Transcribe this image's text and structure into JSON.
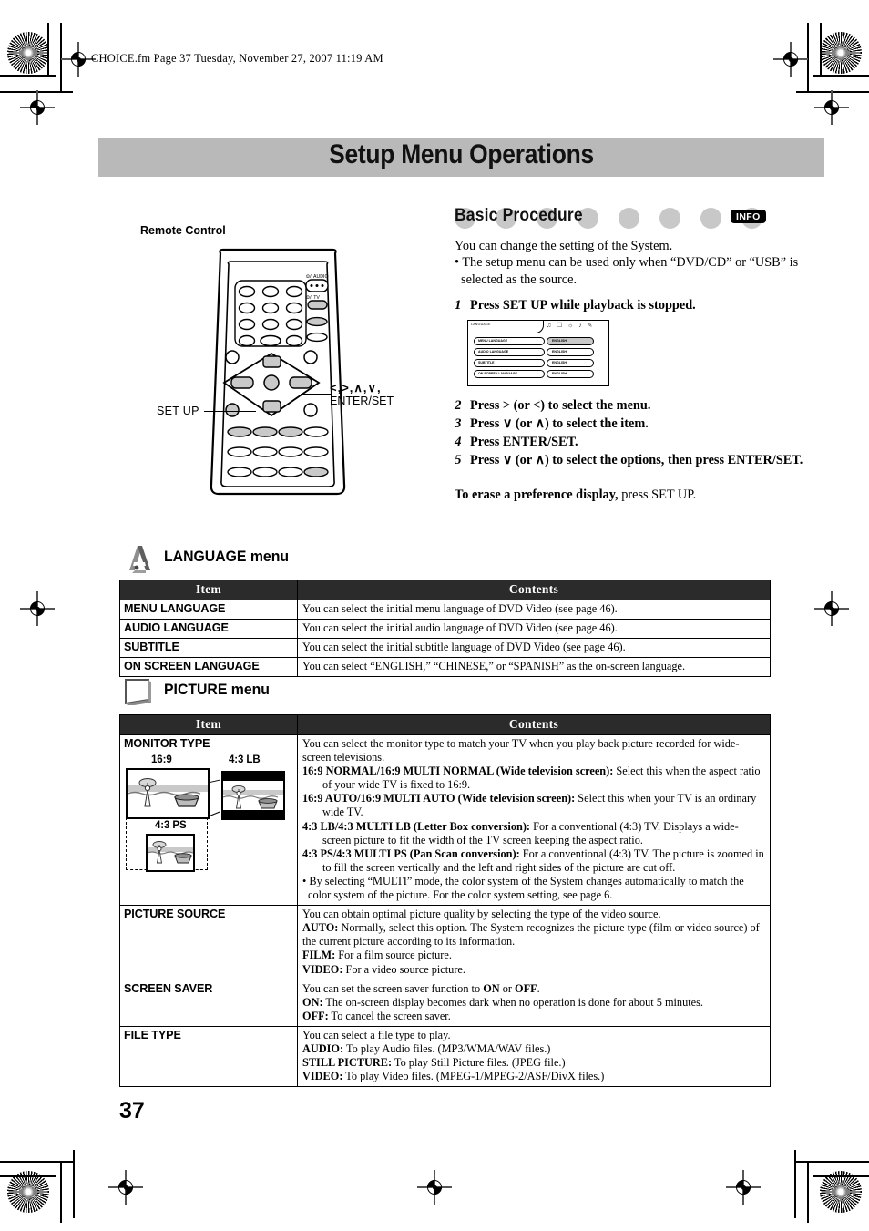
{
  "print_header": "CHOICE.fm  Page 37  Tuesday, November 27, 2007  11:19 AM",
  "page_title": "Setup Menu Operations",
  "page_number": "37",
  "remote_panel": {
    "label": "Remote Control",
    "callout_setup": "SET UP",
    "callout_nav_arrows": "<,>,∧,∨,",
    "callout_nav_enter": "ENTER/SET"
  },
  "basic_procedure": {
    "heading": "Basic Procedure",
    "badge": "INFO",
    "intro": "You can change the setting of the System.",
    "bullet": "• The setup menu can be used only when “DVD/CD” or “USB” is selected as the source.",
    "steps": [
      {
        "num": "1",
        "text": "Press SET UP while playback is stopped."
      },
      {
        "num": "2",
        "text": "Press > (or <) to select the menu."
      },
      {
        "num": "3",
        "text": "Press ∨ (or ∧) to select the item."
      },
      {
        "num": "4",
        "text": "Press ENTER/SET."
      },
      {
        "num": "5",
        "text": "Press ∨ (or ∧) to select the options, then press ENTER/SET."
      }
    ],
    "erase_bold": "To erase a preference display,",
    "erase_rest": " press SET UP."
  },
  "osd": {
    "tab_name": "LANGUAGE",
    "rows": [
      {
        "name": "MENU LANGUAGE",
        "value": "ENGLISH",
        "highlighted": true
      },
      {
        "name": "AUDIO LANGUAGE",
        "value": "ENGLISH",
        "highlighted": false
      },
      {
        "name": "SUBTITLE",
        "value": "ENGLISH",
        "highlighted": false
      },
      {
        "name": "ON SCREEN LANGUAGE",
        "value": "ENGLISH",
        "highlighted": false
      }
    ]
  },
  "language_section": {
    "title": "LANGUAGE menu",
    "col_item": "Item",
    "col_contents": "Contents",
    "rows": [
      {
        "item": "MENU LANGUAGE",
        "contents": "You can select the initial menu language of DVD Video (see page 46)."
      },
      {
        "item": "AUDIO LANGUAGE",
        "contents": "You can select the initial audio language of DVD Video (see page 46)."
      },
      {
        "item": "SUBTITLE",
        "contents": "You can select the initial subtitle language of DVD Video (see page 46)."
      },
      {
        "item": "ON SCREEN LANGUAGE",
        "contents": "You can select “ENGLISH,” “CHINESE,” or “SPANISH” as the on-screen language."
      }
    ]
  },
  "picture_section": {
    "title": "PICTURE menu",
    "col_item": "Item",
    "col_contents": "Contents",
    "monitor_type": {
      "item": "MONITOR TYPE",
      "fig_labels": {
        "wide": "16:9",
        "lb": "4:3 LB",
        "ps": "4:3 PS"
      },
      "intro": "You can select the monitor type to match your TV when you play back picture recorded for wide-screen televisions.",
      "options": [
        {
          "term": "16:9 NORMAL/16:9 MULTI NORMAL (Wide television screen):",
          "desc": " Select this when the aspect ratio of your wide TV is fixed to 16:9."
        },
        {
          "term": "16:9 AUTO/16:9 MULTI AUTO (Wide television screen):",
          "desc": " Select this when your TV is an ordinary wide TV."
        },
        {
          "term": "4:3 LB/4:3 MULTI LB (Letter Box conversion):",
          "desc": " For a conventional (4:3) TV. Displays a wide-screen picture to fit the width of the TV screen keeping the aspect ratio."
        },
        {
          "term": "4:3 PS/4:3 MULTI PS (Pan Scan conversion):",
          "desc": " For a conventional (4:3) TV. The picture is zoomed in to fill the screen vertically and the left and right sides of the picture are cut off."
        }
      ],
      "note": "• By selecting “MULTI” mode, the color system of the System changes automatically to match the color system of the picture. For the color system setting, see page 6."
    },
    "picture_source": {
      "item": "PICTURE SOURCE",
      "intro": "You can obtain optimal picture quality by selecting the type of the video source.",
      "options": [
        {
          "term": "AUTO:",
          "desc": " Normally, select this option. The System recognizes the picture type (film or video source) of the current picture according to its information."
        },
        {
          "term": "FILM:",
          "desc": " For a film source picture."
        },
        {
          "term": "VIDEO:",
          "desc": " For a video source picture."
        }
      ]
    },
    "screen_saver": {
      "item": "SCREEN SAVER",
      "intro_a": "You can set the screen saver function to ",
      "intro_on": "ON",
      "intro_b": " or ",
      "intro_off": "OFF",
      "intro_c": ".",
      "options": [
        {
          "term": "ON:",
          "desc": " The on-screen display becomes dark when no operation is done for about 5 minutes."
        },
        {
          "term": "OFF:",
          "desc": " To cancel the screen saver."
        }
      ]
    },
    "file_type": {
      "item": "FILE TYPE",
      "intro": "You can select a file type to play.",
      "options": [
        {
          "term": "AUDIO:",
          "desc": " To play Audio files. (MP3/WMA/WAV files.)"
        },
        {
          "term": "STILL PICTURE:",
          "desc": " To play Still Picture files. (JPEG file.)"
        },
        {
          "term": "VIDEO:",
          "desc": " To play Video files. (MPEG-1/MPEG-2/ASF/DivX files.)"
        }
      ]
    }
  },
  "colors": {
    "banner_bg": "#b9b9b9",
    "table_header_bg": "#2b2b2b",
    "dot_gray": "#c8c8c8",
    "badge_bg": "#000000"
  }
}
